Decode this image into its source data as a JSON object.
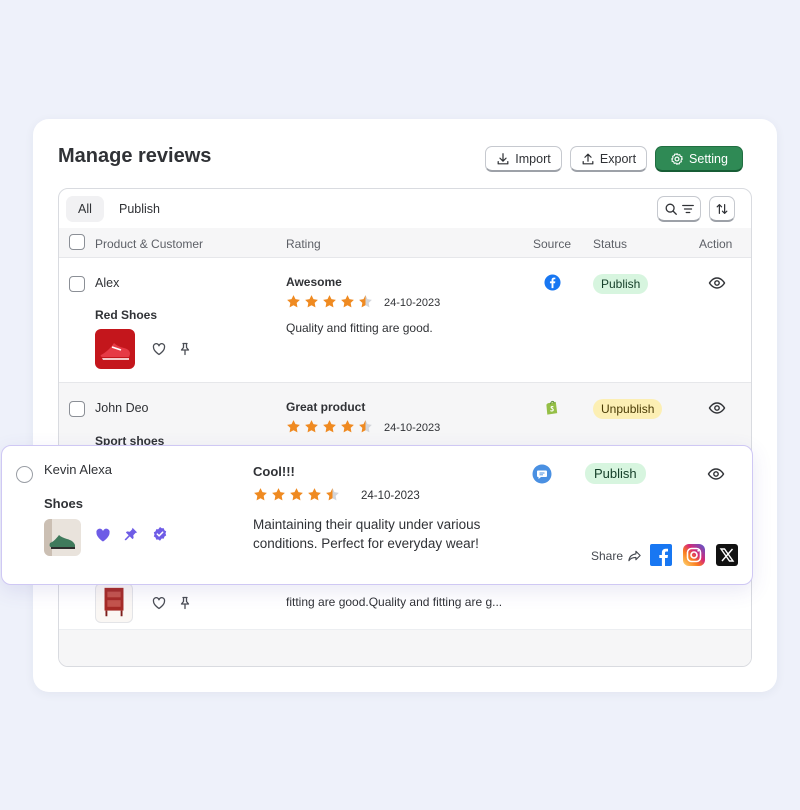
{
  "header": {
    "title": "Manage reviews",
    "import_label": "Import",
    "export_label": "Export",
    "setting_label": "Setting"
  },
  "tabs": [
    {
      "label": "All"
    },
    {
      "label": "Publish"
    }
  ],
  "columns": {
    "product_customer": "Product & Customer",
    "rating": "Rating",
    "source": "Source",
    "status": "Status",
    "action": "Action"
  },
  "rows": [
    {
      "customer": "Alex",
      "product": "Red Shoes",
      "title": "Awesome",
      "stars": 4.5,
      "date": "24-10-2023",
      "text": "Quality and fitting are good.",
      "source_icon": "facebook-icon",
      "status": "Publish"
    },
    {
      "customer": "John Deo",
      "product": "Sport shoes",
      "title": "Great product",
      "stars": 4.5,
      "date": "24-10-2023",
      "source_icon": "shopify-icon",
      "status": "Unpublish"
    },
    {
      "text": "fitting are good.Quality and fitting are g..."
    }
  ],
  "featured": {
    "customer": "Kevin Alexa",
    "product": "Shoes",
    "title": "Cool!!!",
    "stars": 4.5,
    "date": "24-10-2023",
    "text": "Maintaining their quality under various conditions. Perfect for everyday wear!",
    "source_icon": "chat-icon",
    "status": "Publish",
    "share_label": "Share"
  },
  "colors": {
    "accent": "#2f8a55",
    "star": "#ef8a21",
    "highlight": "#6e5ce6",
    "publish_bg": "#d7f5df",
    "unpublish_bg": "#fcefb4"
  }
}
